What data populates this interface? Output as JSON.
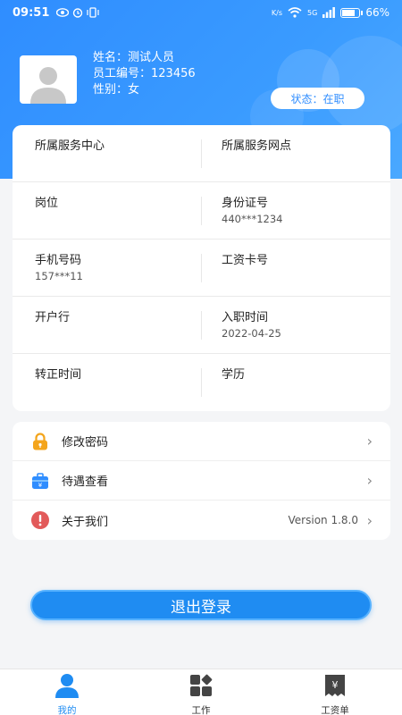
{
  "status_bar": {
    "time": "09:51",
    "net_speed": "K/s",
    "signal": "5G",
    "battery": "66%",
    "battery_level": 0.66
  },
  "profile": {
    "name": "姓名：测试人员",
    "employee_no": "员工编号：123456",
    "gender": "性别：女",
    "status": "状态：在职"
  },
  "info": [
    {
      "left": {
        "label": "所属服务中心",
        "value": ""
      },
      "right": {
        "label": "所属服务网点",
        "value": ""
      }
    },
    {
      "left": {
        "label": "岗位",
        "value": ""
      },
      "right": {
        "label": "身份证号",
        "value": "440***1234"
      }
    },
    {
      "left": {
        "label": "手机号码",
        "value": "157***11"
      },
      "right": {
        "label": "工资卡号",
        "value": ""
      }
    },
    {
      "left": {
        "label": "开户行",
        "value": ""
      },
      "right": {
        "label": "入职时间",
        "value": "2022-04-25"
      }
    },
    {
      "left": {
        "label": "转正时间",
        "value": ""
      },
      "right": {
        "label": "学历",
        "value": ""
      }
    }
  ],
  "menu": [
    {
      "label": "修改密码",
      "extra": "",
      "icon": "lock-icon",
      "color": "#f4a51c"
    },
    {
      "label": "待遇查看",
      "extra": "",
      "icon": "briefcase-icon",
      "color": "#2f8dff"
    },
    {
      "label": "关于我们",
      "extra": "Version 1.8.0",
      "icon": "info-icon",
      "color": "#e25a5a"
    }
  ],
  "logout_label": "退出登录",
  "bottom_nav": [
    {
      "label": "我的",
      "icon": "user-icon",
      "active": true
    },
    {
      "label": "工作",
      "icon": "grid-icon",
      "active": false
    },
    {
      "label": "工资单",
      "icon": "payslip-icon",
      "active": false
    }
  ],
  "colors": {
    "primary": "#1f8cf2",
    "header": "#2f8dff"
  }
}
